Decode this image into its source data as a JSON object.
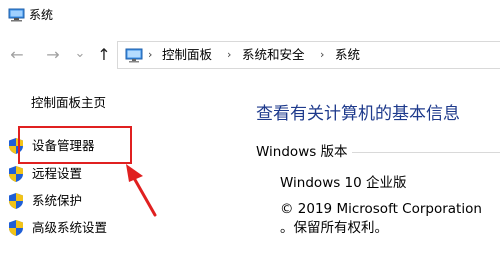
{
  "window": {
    "title": "系统",
    "icon": "computer-icon"
  },
  "navigation": {
    "back_icon": "back-arrow-icon",
    "forward_icon": "forward-arrow-icon",
    "recent_icon": "chevron-down-icon",
    "up_icon": "up-arrow-icon",
    "back_glyph": "←",
    "forward_glyph": "→",
    "recent_glyph": "⌄",
    "up_glyph": "↑",
    "separator_glyph": "›",
    "breadcrumbs": [
      "控制面板",
      "系统和安全",
      "系统"
    ]
  },
  "sidebar": {
    "title": "控制面板主页",
    "items": [
      {
        "label": "设备管理器",
        "icon": "shield-icon"
      },
      {
        "label": "远程设置",
        "icon": "shield-icon"
      },
      {
        "label": "系统保护",
        "icon": "shield-icon"
      },
      {
        "label": "高级系统设置",
        "icon": "shield-icon"
      }
    ],
    "highlighted_item": "设备管理器"
  },
  "main": {
    "heading": "查看有关计算机的基本信息",
    "section_title": "Windows 版本",
    "edition": "Windows 10 企业版",
    "copyright_line1": "© 2019 Microsoft Corporation",
    "copyright_line2": "。保留所有权利。"
  },
  "colors": {
    "heading": "#1e3a8c",
    "highlight": "#e02020",
    "shield_blue": "#1f5fd6",
    "shield_yellow": "#f2c318"
  }
}
